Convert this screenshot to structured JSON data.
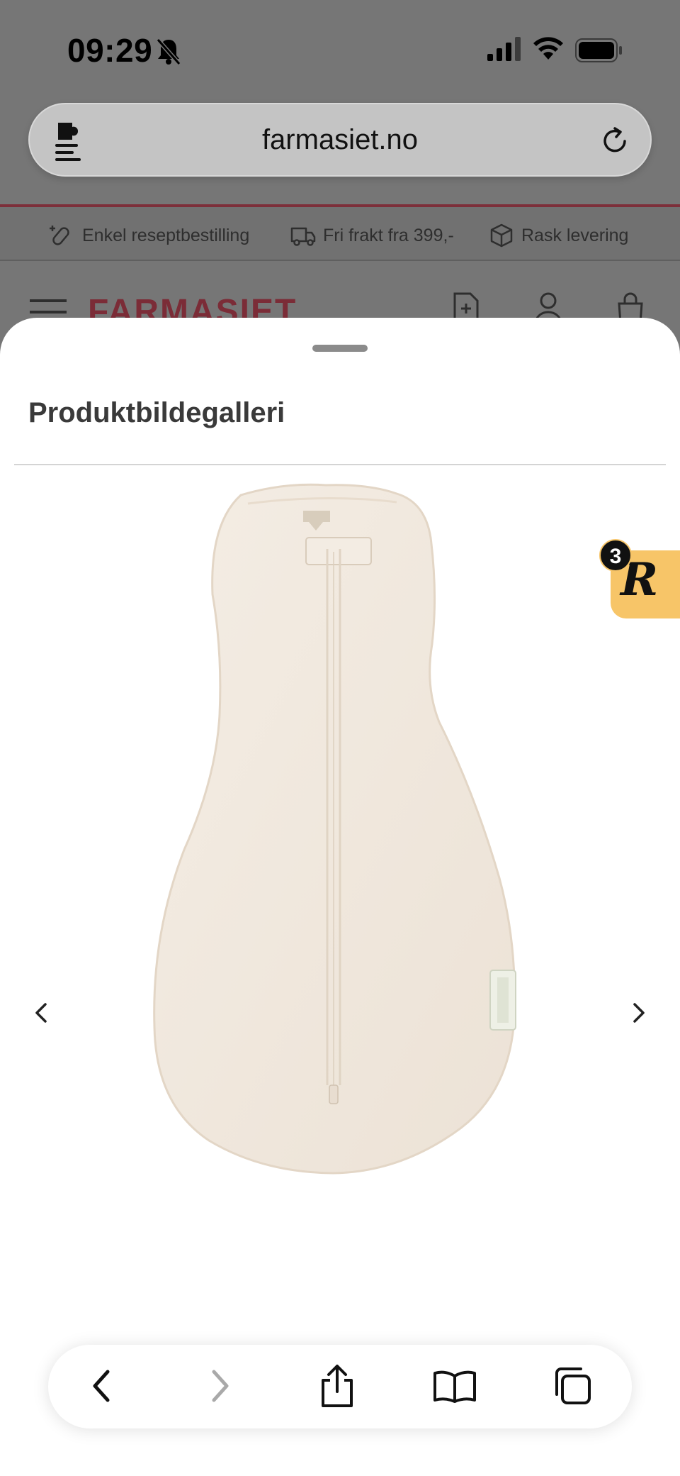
{
  "status_bar": {
    "time": "09:29"
  },
  "browser": {
    "url": "farmasiet.no"
  },
  "site": {
    "promo": [
      {
        "label": "Enkel reseptbestilling",
        "icon": "prescription-icon"
      },
      {
        "label": "Fri frakt fra 399,-",
        "icon": "truck-icon"
      },
      {
        "label": "Rask levering",
        "icon": "package-icon"
      }
    ],
    "logo": "FARMASIET"
  },
  "sheet": {
    "title": "Produktbildegalleri"
  },
  "reviews_badge": {
    "count": "3",
    "letter": "R"
  },
  "colors": {
    "brand": "#7b2c37",
    "badge": "#f7c568",
    "product": "#f1e9df"
  },
  "toolbar": {
    "icons": [
      "back-icon",
      "forward-icon",
      "share-icon",
      "bookmarks-icon",
      "tabs-icon"
    ]
  }
}
